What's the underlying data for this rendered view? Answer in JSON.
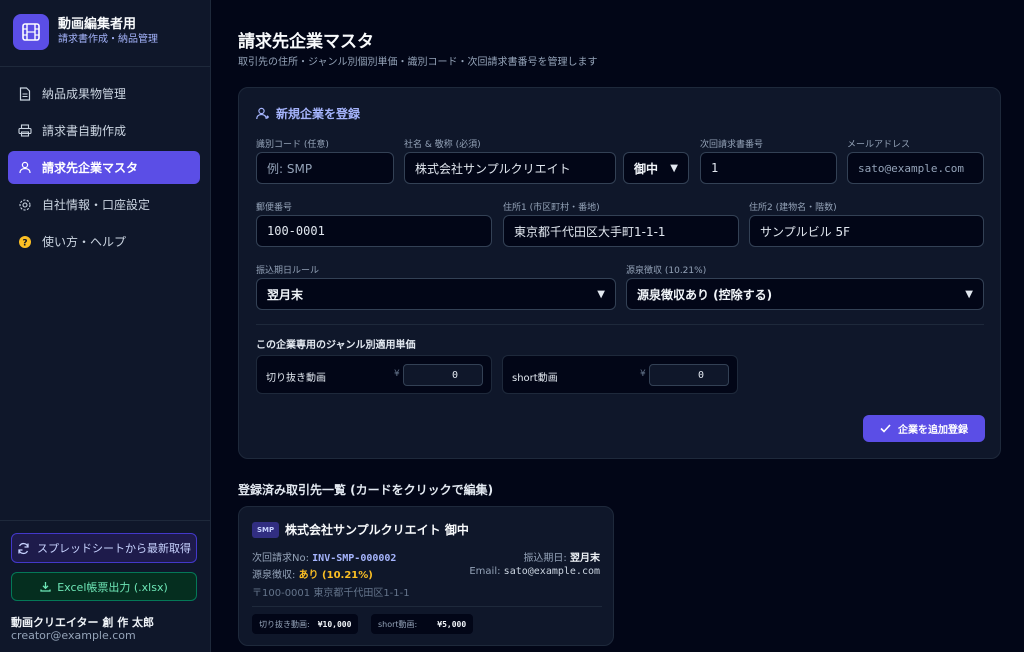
{
  "app": {
    "title": "動画編集者用",
    "subtitle": "請求書作成・納品管理"
  },
  "nav": [
    {
      "label": "納品成果物管理",
      "icon": "document-icon"
    },
    {
      "label": "請求書自動作成",
      "icon": "printer-icon"
    },
    {
      "label": "請求先企業マスタ",
      "icon": "user-icon",
      "active": true
    },
    {
      "label": "自社情報・口座設定",
      "icon": "gear-icon"
    },
    {
      "label": "使い方・ヘルプ",
      "icon": "help-icon"
    }
  ],
  "sidebar": {
    "sync_label": "スプレッドシートから最新取得",
    "excel_label": "Excel帳票出力 (.xlsx)",
    "user_name": "動画クリエイター 創 作 太郎",
    "user_email": "creator@example.com"
  },
  "page": {
    "title": "請求先企業マスタ",
    "subtitle": "取引先の住所・ジャンル別個別単価・識別コード・次回請求書番号を管理します"
  },
  "form": {
    "heading": "新規企業を登録",
    "code": {
      "label": "識別コード (任意)",
      "placeholder": "例: SMP"
    },
    "company": {
      "label": "社名 & 敬称 (必須)",
      "value": "株式会社サンプルクリエイト"
    },
    "honorific": {
      "value": "御中"
    },
    "next_invoice": {
      "label": "次回請求書番号",
      "value": "1"
    },
    "email": {
      "label": "メールアドレス",
      "value": "sato@example.com"
    },
    "postal": {
      "label": "郵便番号",
      "value": "100-0001"
    },
    "address1": {
      "label": "住所1 (市区町村・番地)",
      "value": "東京都千代田区大手町1-1-1"
    },
    "address2": {
      "label": "住所2 (建物名・階数)",
      "value": "サンプルビル 5F"
    },
    "payment_rule": {
      "label": "振込期日ルール",
      "value": "翌月末"
    },
    "withholding": {
      "label": "源泉徴収 (10.21%)",
      "value": "源泉徴収あり (控除する)"
    },
    "genre_heading": "この企業専用のジャンル別適用単価",
    "genres": [
      {
        "name": "切り抜き動画",
        "currency": "¥",
        "value": "0"
      },
      {
        "name": "short動画",
        "currency": "¥",
        "value": "0"
      }
    ],
    "submit_label": "企業を追加登録"
  },
  "list": {
    "heading": "登録済み取引先一覧 (カードをクリックで編集)",
    "cards": [
      {
        "code": "SMP",
        "name": "株式会社サンプルクリエイト 御中",
        "next_label": "次回請求No:",
        "next_value": "INV-SMP-000002",
        "due_label": "振込期日:",
        "due_value": "翌月末",
        "withholding_label": "源泉徴収:",
        "withholding_value": "あり (10.21%)",
        "email_label": "Email:",
        "email_value": "sato@example.com",
        "address": "〒100-0001 東京都千代田区1-1-1",
        "prices": [
          {
            "name": "切り抜き動画:",
            "value": "¥10,000"
          },
          {
            "name": "short動画:",
            "value": "¥5,000"
          }
        ]
      }
    ]
  },
  "colors": {
    "accent": "#5b4ee6",
    "background": "#020617",
    "panel": "#0f172a",
    "amber": "#fbbf24"
  }
}
